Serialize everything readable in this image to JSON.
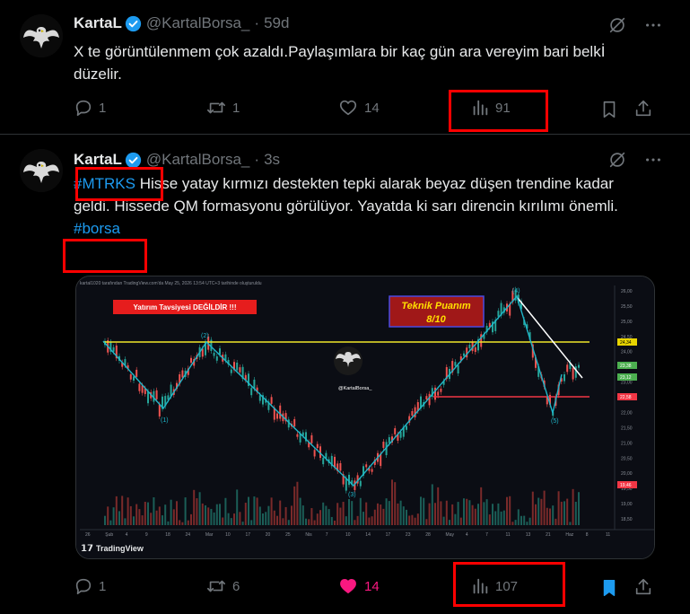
{
  "tweets": [
    {
      "author": {
        "name": "KartaL",
        "handle": "@KartalBorsa_",
        "time_sep": "·",
        "time": "59d"
      },
      "text": "X te görüntülenmem çok azaldı.Paylaşımlara bir kaç gün ara vereyim bari belkİ düzelir.",
      "stats": {
        "replies": "1",
        "reposts": "1",
        "likes": "14",
        "views": "91"
      }
    },
    {
      "author": {
        "name": "KartaL",
        "handle": "@KartalBorsa_",
        "time_sep": "·",
        "time": "3s"
      },
      "hashtag1": "#MTRKS",
      "text": " Hisse yatay kırmızı destekten tepki alarak beyaz düşen trendine kadar geldi. Hissede QM formasyonu görülüyor. Yayatda ki sarı direncin kırılımı önemli.",
      "hashtag2": "#borsa",
      "stats": {
        "replies": "1",
        "reposts": "6",
        "likes": "14",
        "views": "107"
      },
      "chart": {
        "header_text": "kartal1020 tarafından TradingView.com'da May 25, 2026 13:54 UTC+3 tarihinde oluşturuldu",
        "warning": "Yatırım Tavsiyesi DEĞİLDİR !!!",
        "score_title": "Teknik Puanım",
        "score_value": "8/10",
        "watermark": "@KartalBorsa_",
        "brand": "TradingView",
        "point_labels": [
          "(1)",
          "(2)",
          "(3)",
          "(4)",
          "(5)"
        ],
        "price_ticks": [
          "26,00",
          "25,50",
          "25,00",
          "24,50",
          "24,00",
          "23,50",
          "23,00",
          "22,50",
          "22,00",
          "21,50",
          "21,00",
          "20,50",
          "20,00",
          "19,50",
          "19,00",
          "18,50"
        ],
        "price_tags": [
          {
            "label": "24,34",
            "color": "#e8d400"
          },
          {
            "label": "23,38",
            "color": "#4caf50"
          },
          {
            "label": "23,12",
            "color": "#4caf50"
          },
          {
            "label": "22,58",
            "color": "#f23645"
          },
          {
            "label": "19,46",
            "color": "#f23645"
          }
        ],
        "date_ticks": [
          "26",
          "Şub",
          "4",
          "9",
          "18",
          "24",
          "Mar",
          "10",
          "17",
          "20",
          "25",
          "Nis",
          "7",
          "10",
          "14",
          "17",
          "23",
          "28",
          "May",
          "4",
          "7",
          "11",
          "13",
          "21",
          "Haz",
          "8",
          "11"
        ]
      }
    }
  ]
}
